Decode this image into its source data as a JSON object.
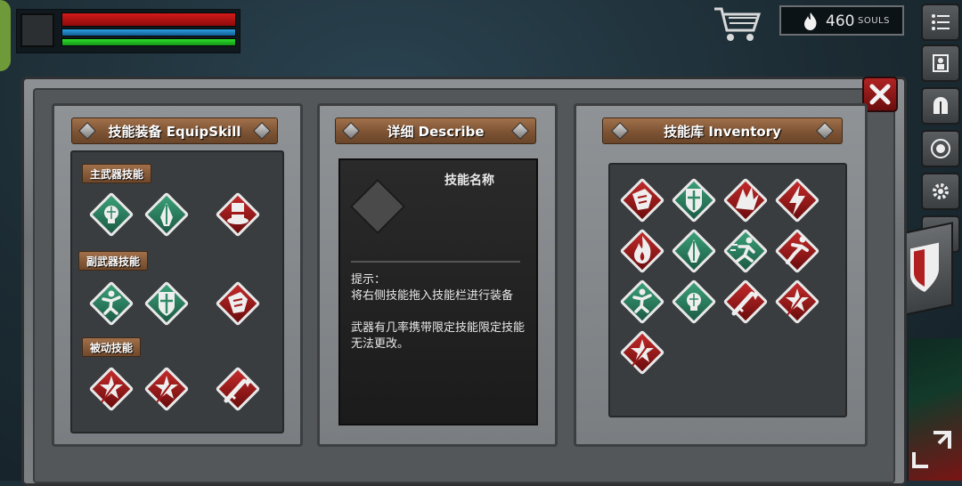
{
  "hud": {
    "souls_value": "460",
    "souls_label": "SOULS"
  },
  "panels": {
    "equip": {
      "title": "技能装备 EquipSkill",
      "primary_label": "主武器技能",
      "secondary_label": "副武器技能",
      "passive_label": "被动技能",
      "primary_skills": [
        {
          "icon": "brain-icon",
          "color": "green"
        },
        {
          "icon": "praying-hands-icon",
          "color": "green"
        },
        {
          "icon": "top-hat-icon",
          "color": "red"
        }
      ],
      "secondary_skills": [
        {
          "icon": "leaping-figure-icon",
          "color": "green"
        },
        {
          "icon": "shield-cross-icon",
          "color": "green"
        },
        {
          "icon": "gauntlet-icon",
          "color": "red"
        }
      ],
      "passive_skills": [
        {
          "icon": "sword-burst-icon",
          "color": "red"
        },
        {
          "icon": "sword-burst-icon",
          "color": "red"
        },
        {
          "icon": "sword-sparkle-icon",
          "color": "red"
        }
      ]
    },
    "describe": {
      "title": "详细 Describe",
      "skill_name": "技能名称",
      "hint_text": "提示：\n将右侧技能拖入技能栏进行装备\n\n武器有几率携带限定技能限定技能无法更改。"
    },
    "inventory": {
      "title": "技能库 Inventory",
      "skills": [
        {
          "icon": "gauntlet-icon",
          "color": "red"
        },
        {
          "icon": "shield-cross-icon",
          "color": "green"
        },
        {
          "icon": "wing-slash-icon",
          "color": "red"
        },
        {
          "icon": "lightning-icon",
          "color": "red"
        },
        {
          "icon": "fire-icon",
          "color": "red"
        },
        {
          "icon": "praying-hands-icon",
          "color": "green"
        },
        {
          "icon": "dash-figure-icon",
          "color": "green"
        },
        {
          "icon": "sprint-figure-icon",
          "color": "red"
        },
        {
          "icon": "leaping-figure-icon",
          "color": "green"
        },
        {
          "icon": "brain-icon",
          "color": "green"
        },
        {
          "icon": "sword-sparkle-icon",
          "color": "red"
        },
        {
          "icon": "sword-burst-icon",
          "color": "red"
        },
        {
          "icon": "sword-burst-icon",
          "color": "red"
        }
      ]
    }
  },
  "side_menu": [
    "menu-list-icon",
    "character-icon",
    "helmet-icon",
    "relic-icon",
    "settings-gear-icon",
    "help-question-icon"
  ],
  "colors": {
    "green_skill": "#2f8a66",
    "red_skill": "#a01818",
    "hp": "#c01616",
    "mp": "#1f86c6",
    "stamina": "#22c41e"
  }
}
